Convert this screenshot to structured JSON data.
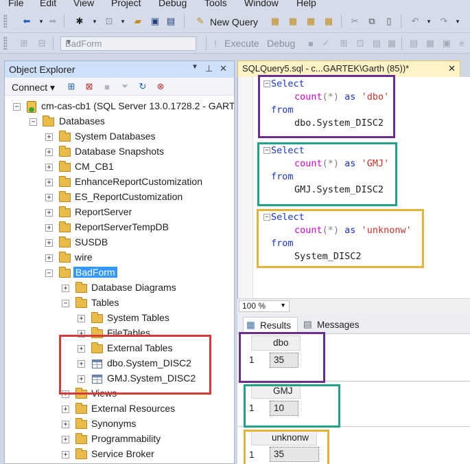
{
  "menu": [
    "File",
    "Edit",
    "View",
    "Project",
    "Debug",
    "Tools",
    "Window",
    "Help"
  ],
  "toolbar1": {
    "new_query_label": "New Query"
  },
  "toolbar2": {
    "database": "BadForm",
    "execute_label": "Execute",
    "debug_label": "Debug"
  },
  "object_explorer": {
    "title": "Object Explorer",
    "pin_glyph": "▾ ᛘ ✕",
    "connect_label": "Connect",
    "server": "cm-cas-cb1 (SQL Server 13.0.1728.2 - GART",
    "nodes": [
      "Databases",
      "System Databases",
      "Database Snapshots",
      "CM_CB1",
      "EnhanceReportCustomization",
      "ES_ReportCustomization",
      "ReportServer",
      "ReportServerTempDB",
      "SUSDB",
      "wire",
      "BadForm",
      "Database Diagrams",
      "Tables",
      "System Tables",
      "FileTables",
      "External Tables",
      "dbo.System_DISC2",
      "GMJ.System_DISC2",
      "Views",
      "External Resources",
      "Synonyms",
      "Programmability",
      "Service Broker"
    ]
  },
  "query_tab": {
    "label": "SQLQuery5.sql - c...GARTEK\\Garth (85))*"
  },
  "queries": [
    {
      "select": "Select",
      "count": "count",
      "paren": "(*)",
      "as": "as",
      "alias": "'dbo'",
      "from": "from",
      "table": "dbo.System_DISC2"
    },
    {
      "select": "Select",
      "count": "count",
      "paren": "(*)",
      "as": "as",
      "alias": "'GMJ'",
      "from": "from",
      "table": "GMJ.System_DISC2"
    },
    {
      "select": "Select",
      "count": "count",
      "paren": "(*)",
      "as": "as",
      "alias": "'unknonw'",
      "from": "from",
      "table": "System_DISC2"
    }
  ],
  "zoom": "100 %",
  "result_tabs": {
    "results": "Results",
    "messages": "Messages"
  },
  "results": [
    {
      "column": "dbo",
      "row": "1",
      "value": "35"
    },
    {
      "column": "GMJ",
      "row": "1",
      "value": "10"
    },
    {
      "column": "unknonw",
      "row": "1",
      "value": "35"
    }
  ],
  "colors": {
    "purple": "#6a2f8e",
    "teal": "#21a38a",
    "gold": "#e2b43a",
    "red": "#d83a3a",
    "selection": "#3399ff"
  }
}
